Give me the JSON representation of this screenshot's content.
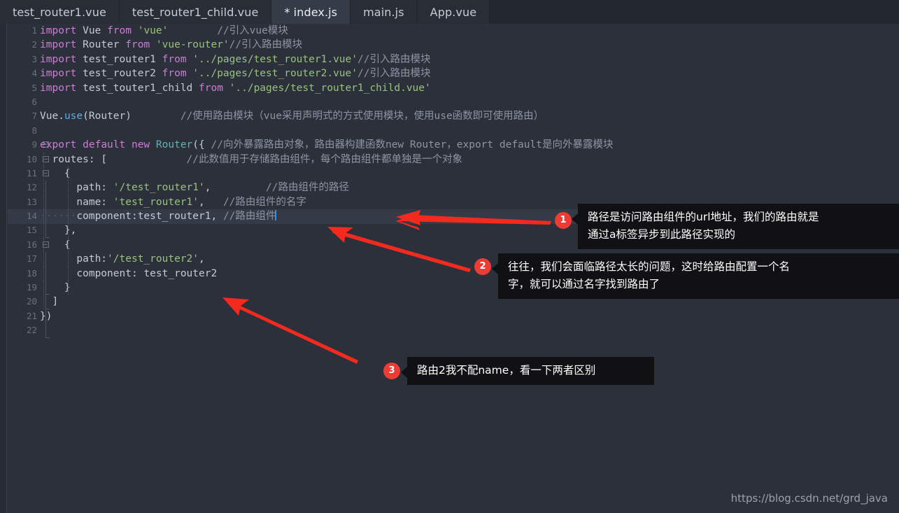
{
  "window": {
    "title": "index.js - code editor",
    "watermark": "https://blog.csdn.net/grd_java"
  },
  "tabs": [
    {
      "label": "test_router1.vue",
      "active": false,
      "modified": false
    },
    {
      "label": "test_router1_child.vue",
      "active": false,
      "modified": false
    },
    {
      "label": "* index.js",
      "active": true,
      "modified": true
    },
    {
      "label": "main.js",
      "active": false,
      "modified": false
    },
    {
      "label": "App.vue",
      "active": false,
      "modified": false
    }
  ],
  "editor": {
    "language": "javascript",
    "current_line": 14,
    "line_numbers": [
      "1",
      "2",
      "3",
      "4",
      "5",
      "6",
      "7",
      "8",
      "9",
      "10",
      "11",
      "12",
      "13",
      "14",
      "15",
      "16",
      "17",
      "18",
      "19",
      "20",
      "21",
      "22"
    ],
    "lines": [
      {
        "n": "1",
        "code": "import Vue from 'vue'",
        "comment": "//引入vue模块"
      },
      {
        "n": "2",
        "code": "import Router from 'vue-router'",
        "comment": "//引入路由模块"
      },
      {
        "n": "3",
        "code": "import test_router1 from '../pages/test_router1.vue'",
        "comment": "//引入路由模块"
      },
      {
        "n": "4",
        "code": "import test_router2 from '../pages/test_router2.vue'",
        "comment": "//引入路由模块"
      },
      {
        "n": "5",
        "code": "import test_touter1_child from '../pages/test_router1_child.vue'",
        "comment": ""
      },
      {
        "n": "6",
        "code": "",
        "comment": ""
      },
      {
        "n": "7",
        "code": "Vue.use(Router)",
        "comment": "//使用路由模块（vue采用声明式的方式使用模块，使用use函数即可使用路由）"
      },
      {
        "n": "8",
        "code": "",
        "comment": ""
      },
      {
        "n": "9",
        "code": "export default new Router({",
        "comment": "//向外暴露路由对象，路由器构建函数new Router，export default是向外暴露模块"
      },
      {
        "n": "10",
        "code": "  routes: [",
        "comment": "//此数值用于存储路由组件，每个路由组件都单独是一个对象"
      },
      {
        "n": "11",
        "code": "    {",
        "comment": ""
      },
      {
        "n": "12",
        "code": "      path: '/test_router1',",
        "comment": "//路由组件的路径"
      },
      {
        "n": "13",
        "code": "      name: 'test_router1',",
        "comment": "//路由组件的名字"
      },
      {
        "n": "14",
        "code": "      component:test_router1,",
        "comment": "//路由组件"
      },
      {
        "n": "15",
        "code": "    },",
        "comment": ""
      },
      {
        "n": "16",
        "code": "    {",
        "comment": ""
      },
      {
        "n": "17",
        "code": "      path:'/test_router2',",
        "comment": ""
      },
      {
        "n": "18",
        "code": "      component: test_router2",
        "comment": ""
      },
      {
        "n": "19",
        "code": "    }",
        "comment": ""
      },
      {
        "n": "20",
        "code": "  ]",
        "comment": ""
      },
      {
        "n": "21",
        "code": "})",
        "comment": ""
      },
      {
        "n": "22",
        "code": "",
        "comment": ""
      }
    ],
    "tokens": {
      "l1": {
        "kw1": "import",
        "id1": "Vue",
        "kw2": "from",
        "str": "'vue'",
        "cmt": "//引入vue模块"
      },
      "l2": {
        "kw1": "import",
        "id1": "Router",
        "kw2": "from",
        "str": "'vue-router'",
        "cmt": "//引入路由模块"
      },
      "l3": {
        "kw1": "import",
        "id1": "test_router1",
        "kw2": "from",
        "str": "'../pages/test_router1.vue'",
        "cmt": "//引入路由模块"
      },
      "l4": {
        "kw1": "import",
        "id1": "test_router2",
        "kw2": "from",
        "str": "'../pages/test_router2.vue'",
        "cmt": "//引入路由模块"
      },
      "l5": {
        "kw1": "import",
        "id1": "test_touter1_child",
        "kw2": "from",
        "str": "'../pages/test_router1_child.vue'"
      },
      "l7": {
        "obj": "Vue",
        "dot": ".",
        "fn": "use",
        "open": "(",
        "arg": "Router",
        "close": ")",
        "cmt": "//使用路由模块（vue采用声明式的方式使用模块，使用use函数即可使用路由）"
      },
      "l9": {
        "kw1": "export",
        "kw2": "default",
        "kw3": "new",
        "cls": "Router",
        "open": "({",
        "cmt": "//向外暴露路由对象，路由器构建函数new Router，export default是向外暴露模块"
      },
      "l10": {
        "prop": "routes:",
        "open": "[",
        "cmt": "//此数值用于存储路由组件，每个路由组件都单独是一个对象"
      },
      "l11": {
        "open": "{"
      },
      "l12": {
        "prop": "path:",
        "str": "'/test_router1'",
        "comma": ",",
        "cmt": "//路由组件的路径"
      },
      "l13": {
        "prop": "name:",
        "str": "'test_router1'",
        "comma": ",",
        "cmt": "//路由组件的名字"
      },
      "l14": {
        "prop": "component:",
        "id": "test_router1",
        "comma": ",",
        "cmt": "//路由组件"
      },
      "l15": {
        "close": "},"
      },
      "l16": {
        "open": "{"
      },
      "l17": {
        "prop": "path:",
        "str": "'/test_router2'",
        "comma": ","
      },
      "l18": {
        "prop": "component:",
        "id": "test_router2"
      },
      "l19": {
        "close": "}"
      },
      "l20": {
        "close": "]"
      },
      "l21": {
        "close": "})"
      }
    }
  },
  "annotations": [
    {
      "number": "1",
      "text_line1": "路径是访问路由组件的url地址，我们的路由就是",
      "text_line2": "通过a标签异步到此路径实现的",
      "target": "line 12 path"
    },
    {
      "number": "2",
      "text_line1": "往往，我们会面临路径太长的问题，这时给路由配置一个名",
      "text_line2": "字，就可以通过名字找到路由了",
      "target": "line 13 name"
    },
    {
      "number": "3",
      "text_line1": "路由2我不配name，看一下两者区别",
      "text_line2": "",
      "target": "line 17 path"
    }
  ],
  "colors": {
    "editor_bg": "#2b303b",
    "tabbar_bg": "#232830",
    "tab_active_bg": "#363c47",
    "keyword": "#cc7dd4",
    "string": "#99c27c",
    "comment": "#8d94a2",
    "class": "#62b3b2",
    "identifier": "#c3cbd6",
    "annotation_red": "#ee3b33",
    "callout_bg": "#111114",
    "current_line": "#343b47"
  }
}
